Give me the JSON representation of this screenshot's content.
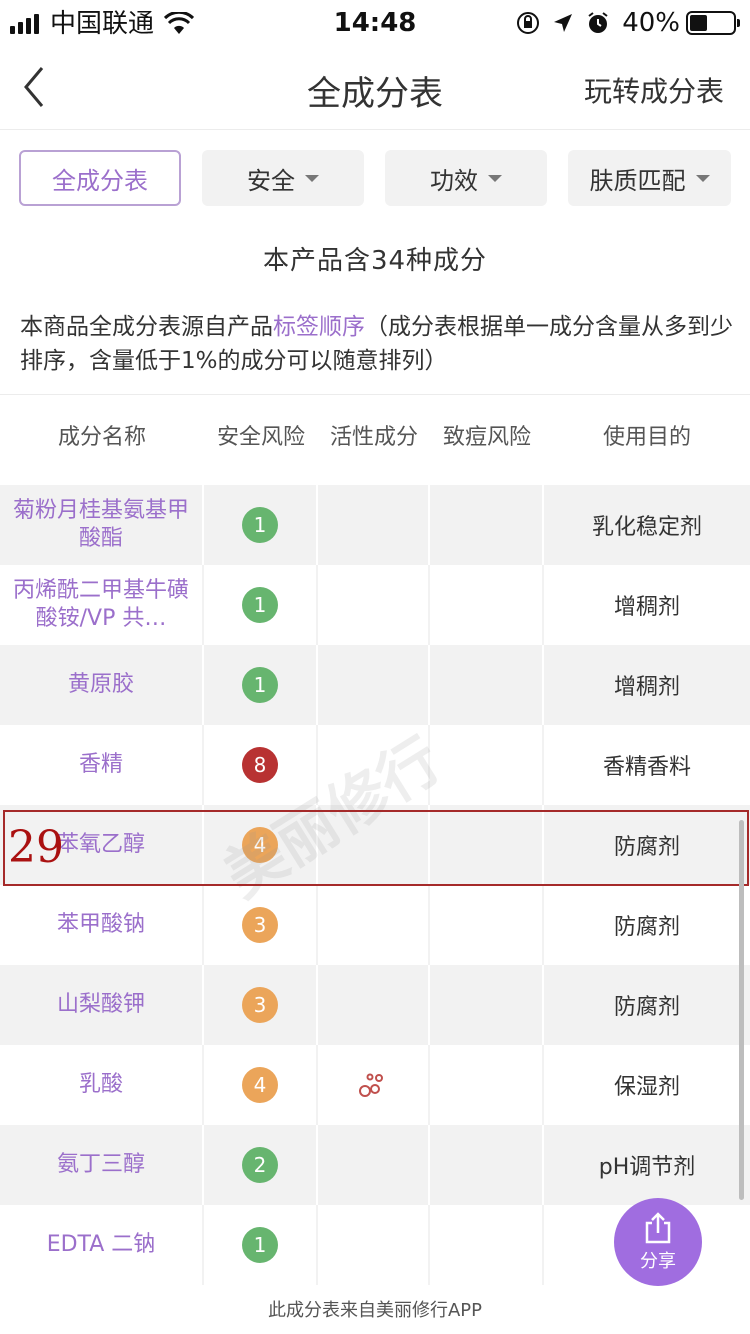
{
  "status_bar": {
    "carrier": "中国联通",
    "time": "14:48",
    "battery": "40%"
  },
  "nav": {
    "title": "全成分表",
    "right_link": "玩转成分表"
  },
  "filters": [
    {
      "label": "全成分表"
    },
    {
      "label": "安全"
    },
    {
      "label": "功效"
    },
    {
      "label": "肤质匹配"
    }
  ],
  "summary": {
    "count_text": "本产品含34种成分",
    "desc_before": "本商品全成分表源自产品",
    "desc_link": "标签顺序",
    "desc_after": "（成分表根据单一成分含量从多到少排序，含量低于1%的成分可以随意排列）"
  },
  "table": {
    "headers": [
      "成分名称",
      "安全风险",
      "活性成分",
      "致痘风险",
      "使用目的"
    ],
    "rows": [
      {
        "name": "菊粉月桂基氨基甲酸酯",
        "risk": "1",
        "purpose": "乳化稳定剂"
      },
      {
        "name": "丙烯酰二甲基牛磺酸铵/VP 共…",
        "risk": "1",
        "purpose": "增稠剂"
      },
      {
        "name": "黄原胶",
        "risk": "1",
        "purpose": "增稠剂"
      },
      {
        "name": "香精",
        "risk": "8",
        "purpose": "香精香料"
      },
      {
        "name": "苯氧乙醇",
        "risk": "4",
        "purpose": "防腐剂"
      },
      {
        "name": "苯甲酸钠",
        "risk": "3",
        "purpose": "防腐剂"
      },
      {
        "name": "山梨酸钾",
        "risk": "3",
        "purpose": "防腐剂"
      },
      {
        "name": "乳酸",
        "risk": "4",
        "purpose": "保湿剂"
      },
      {
        "name": "氨丁三醇",
        "risk": "2",
        "purpose": "pH调节剂"
      },
      {
        "name": "EDTA 二钠",
        "risk": "1",
        "purpose": ""
      }
    ]
  },
  "highlight_label": "29",
  "watermark": "美丽修行",
  "share": {
    "label": "分享"
  },
  "footer": "此成分表来自美丽修行APP",
  "colors": {
    "accent": "#9b6fcb",
    "risk_low": "#67b56f",
    "risk_mid": "#eba55a",
    "risk_high": "#b83232",
    "highlight": "#a52a2a"
  }
}
